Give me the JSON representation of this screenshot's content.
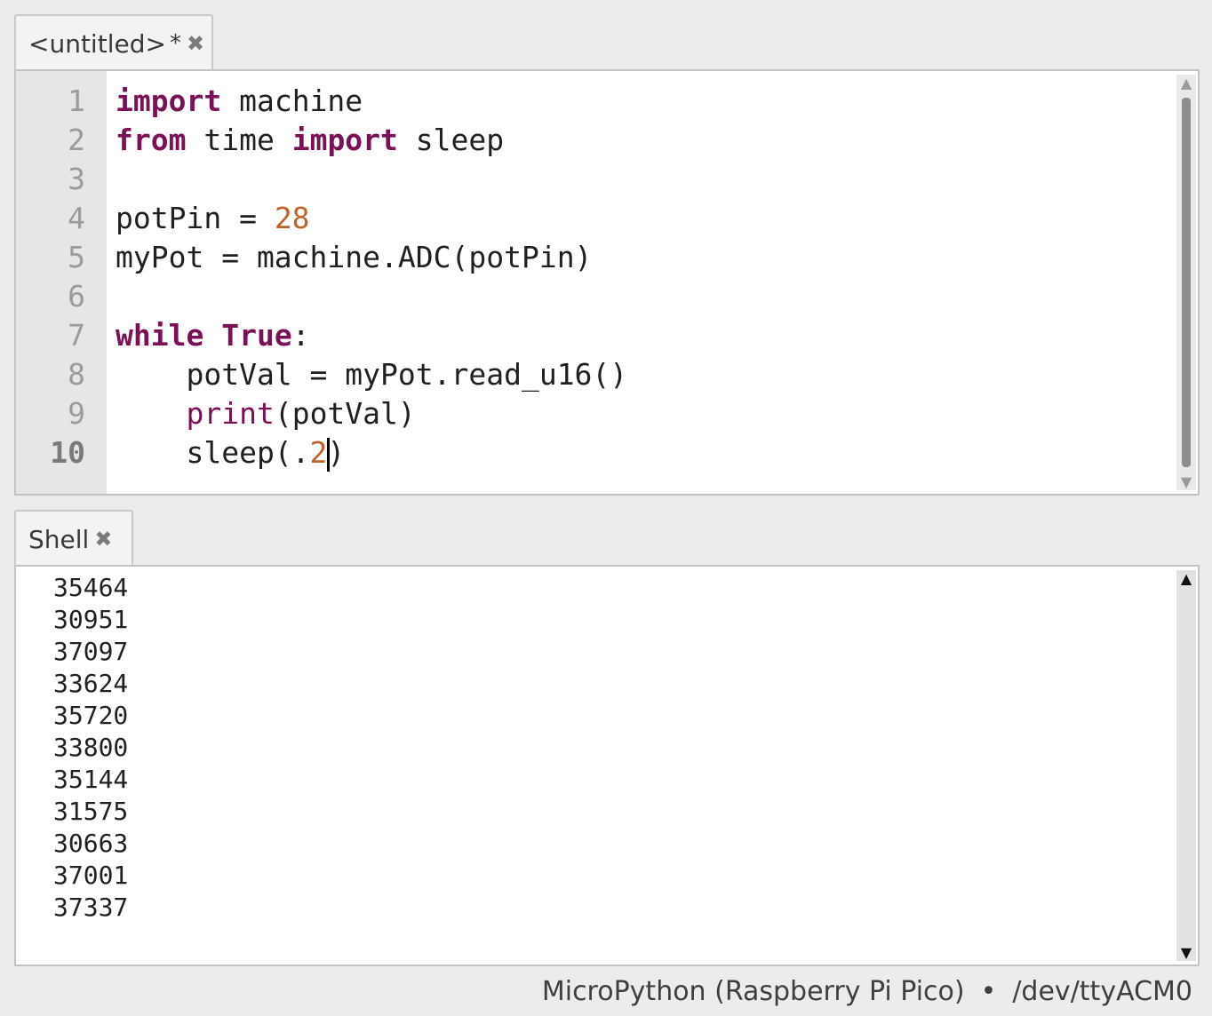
{
  "editor_tab": {
    "title": "<untitled>",
    "modified_marker": "*"
  },
  "editor": {
    "line_numbers": [
      "1",
      "2",
      "3",
      "4",
      "5",
      "6",
      "7",
      "8",
      "9",
      "10"
    ],
    "current_line": "10"
  },
  "code": {
    "l1": {
      "kw": "import",
      "rest": " machine"
    },
    "l2": {
      "kw1": "from",
      "mid": " time ",
      "kw2": "import",
      "rest": " sleep"
    },
    "l4": {
      "lhs": "potPin = ",
      "num": "28"
    },
    "l5": {
      "text": "myPot = machine.ADC(potPin)"
    },
    "l7": {
      "kw1": "while",
      "sp": " ",
      "kw2": "True",
      "rest": ":"
    },
    "l8": {
      "text": "    potVal = myPot.read_u16()"
    },
    "l9": {
      "indent": "    ",
      "fn": "print",
      "rest": "(potVal)"
    },
    "l10": {
      "pre": "    sleep(.",
      "num": "2",
      "post": ")"
    }
  },
  "shell_tab": {
    "title": "Shell"
  },
  "shell": {
    "output": [
      "35464",
      "30951",
      "37097",
      "33624",
      "35720",
      "33800",
      "35144",
      "31575",
      "30663",
      "37001",
      "37337"
    ]
  },
  "status": {
    "interpreter": "MicroPython (Raspberry Pi Pico)",
    "separator": "•",
    "port": "/dev/ttyACM0"
  },
  "icons": {
    "close": "close-icon",
    "scroll_up": "scroll-up-arrow-icon",
    "scroll_down": "scroll-down-arrow-icon"
  },
  "colors": {
    "keyword": "#7a1056",
    "number": "#c0642b",
    "gutter": "#e6e6e6"
  }
}
